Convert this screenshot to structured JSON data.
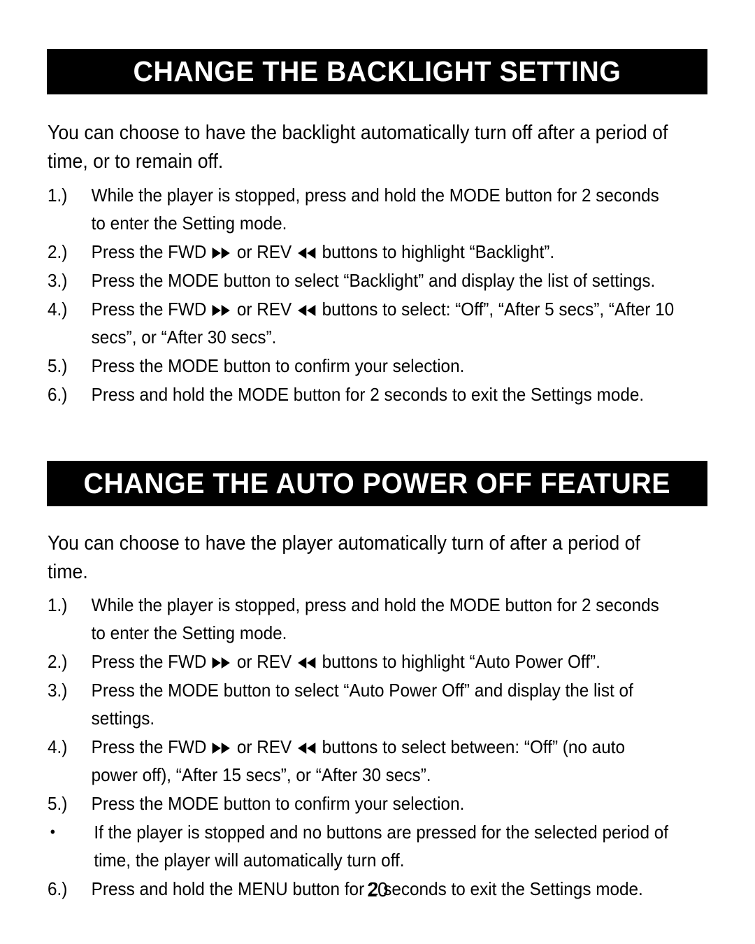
{
  "page": {
    "number": "20",
    "background_color": "#ffffff",
    "text_color": "#000000",
    "header_bar_color": "#000000",
    "header_text_color": "#ffffff"
  },
  "sections": [
    {
      "heading": "CHANGE THE BACKLIGHT SETTING",
      "intro": "You can choose to have the backlight automatically turn off after a period of time, or to remain off.",
      "steps": [
        {
          "marker": "1.)",
          "marker_type": "number",
          "text_parts": [
            {
              "type": "text",
              "value": "While the player is stopped, press and hold the MODE button for 2 seconds to enter the Setting mode."
            }
          ]
        },
        {
          "marker": "2.)",
          "marker_type": "number",
          "text_parts": [
            {
              "type": "text",
              "value": "Press the FWD "
            },
            {
              "type": "icon",
              "value": "fast-forward-icon"
            },
            {
              "type": "text",
              "value": " or REV "
            },
            {
              "type": "icon",
              "value": "rewind-icon"
            },
            {
              "type": "text",
              "value": " buttons to highlight “Backlight”."
            }
          ]
        },
        {
          "marker": "3.)",
          "marker_type": "number",
          "text_parts": [
            {
              "type": "text",
              "value": "Press the MODE button to select “Backlight” and display the list of settings."
            }
          ]
        },
        {
          "marker": "4.)",
          "marker_type": "number",
          "text_parts": [
            {
              "type": "text",
              "value": "Press the FWD "
            },
            {
              "type": "icon",
              "value": "fast-forward-icon"
            },
            {
              "type": "text",
              "value": " or REV "
            },
            {
              "type": "icon",
              "value": "rewind-icon"
            },
            {
              "type": "text",
              "value": " buttons to select: “Off”, “After 5 secs”, “After 10 secs”, or “After 30 secs”."
            }
          ]
        },
        {
          "marker": "5.)",
          "marker_type": "number",
          "text_parts": [
            {
              "type": "text",
              "value": "Press the MODE button to confirm your selection."
            }
          ]
        },
        {
          "marker": "6.)",
          "marker_type": "number",
          "text_parts": [
            {
              "type": "text",
              "value": "Press and hold the MODE button for 2 seconds to exit the Settings mode."
            }
          ]
        }
      ]
    },
    {
      "heading": "CHANGE THE AUTO POWER OFF FEATURE",
      "intro": "You can choose to have the player automatically turn of after a period of time.",
      "steps": [
        {
          "marker": "1.)",
          "marker_type": "number",
          "text_parts": [
            {
              "type": "text",
              "value": "While the player is stopped, press and hold the MODE button for 2 seconds to enter the Setting mode."
            }
          ]
        },
        {
          "marker": "2.)",
          "marker_type": "number",
          "text_parts": [
            {
              "type": "text",
              "value": "Press the FWD "
            },
            {
              "type": "icon",
              "value": "fast-forward-icon"
            },
            {
              "type": "text",
              "value": " or REV "
            },
            {
              "type": "icon",
              "value": "rewind-icon"
            },
            {
              "type": "text",
              "value": " buttons to highlight “Auto Power Off”."
            }
          ]
        },
        {
          "marker": "3.)",
          "marker_type": "number",
          "text_parts": [
            {
              "type": "text",
              "value": "Press the MODE button to select “Auto Power Off” and display the list of settings."
            }
          ]
        },
        {
          "marker": "4.)",
          "marker_type": "number",
          "text_parts": [
            {
              "type": "text",
              "value": "Press the FWD "
            },
            {
              "type": "icon",
              "value": "fast-forward-icon"
            },
            {
              "type": "text",
              "value": " or REV "
            },
            {
              "type": "icon",
              "value": "rewind-icon"
            },
            {
              "type": "text",
              "value": " buttons to select between: “Off” (no auto power off), “After 15 secs”, or “After 30 secs”."
            }
          ]
        },
        {
          "marker": "5.)",
          "marker_type": "number",
          "text_parts": [
            {
              "type": "text",
              "value": "Press the MODE button to confirm your selection."
            }
          ]
        },
        {
          "marker": "•",
          "marker_type": "bullet",
          "text_parts": [
            {
              "type": "text",
              "value": "If the player is stopped and no buttons are pressed for the selected period of time, the player will automatically turn off."
            }
          ]
        },
        {
          "marker": "6.)",
          "marker_type": "number",
          "text_parts": [
            {
              "type": "text",
              "value": "Press and hold the MENU button for 2 seconds to exit the Settings mode."
            }
          ]
        }
      ]
    }
  ]
}
